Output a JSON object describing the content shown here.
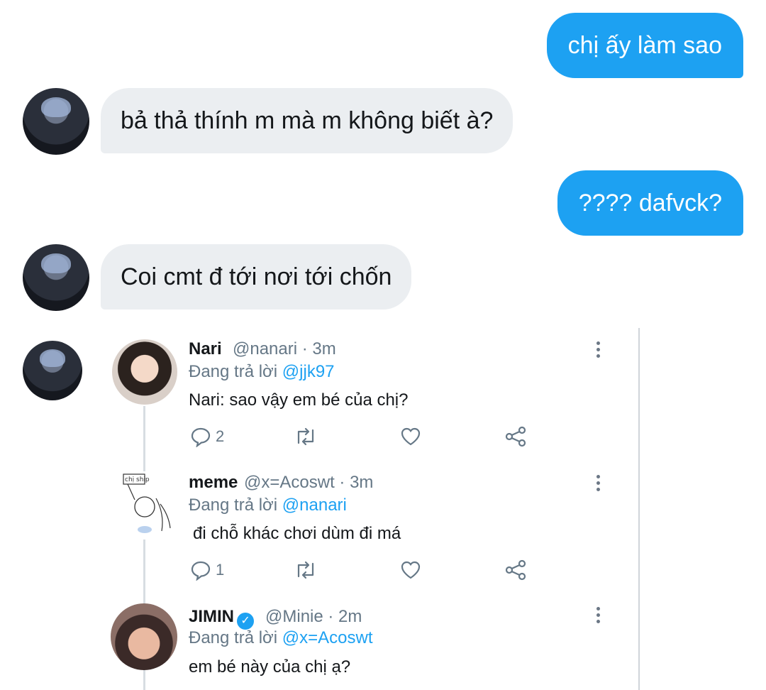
{
  "messages": [
    {
      "side": "out",
      "text": "chị ấy làm sao"
    },
    {
      "side": "in",
      "text": "bả thả thính m mà m không biết à?"
    },
    {
      "side": "out",
      "text": "???? dafvck?"
    },
    {
      "side": "in",
      "text": "Coi cmt đ tới nơi tới chốn"
    }
  ],
  "thread": [
    {
      "name": "Nari",
      "handle": "@nanari · 3m",
      "replying_prefix": "Đang trả lời ",
      "replying_to": "@jjk97",
      "text": "Nari: sao vậy em bé của chị?",
      "reply_count": "2",
      "avatar": "girl-portrait"
    },
    {
      "name": "meme",
      "handle": "@x=Acoswt · 3m",
      "replying_prefix": "Đang trả lời ",
      "replying_to": "@nanari",
      "text": "đi chỗ khác chơi dùm đi má",
      "reply_count": "1",
      "avatar": "sketch-drawing",
      "sketch_sign": "chị ship"
    },
    {
      "name": "JIMIN",
      "verified": true,
      "handle": "@Minie · 2m",
      "replying_prefix": "Đang trả lời ",
      "replying_to": "@x=Acoswt",
      "text": "em bé này của chị ạ?",
      "avatar": "jimin-photo"
    }
  ],
  "icons": {
    "reply": "comment-icon",
    "retweet": "retweet-icon",
    "like": "heart-icon",
    "share": "share-icon",
    "more": "more-vertical-icon",
    "verified": "verified-badge-icon"
  },
  "colors": {
    "accent": "#1da1f2",
    "incoming_bubble": "#ebeef1",
    "secondary_text": "#657786"
  }
}
